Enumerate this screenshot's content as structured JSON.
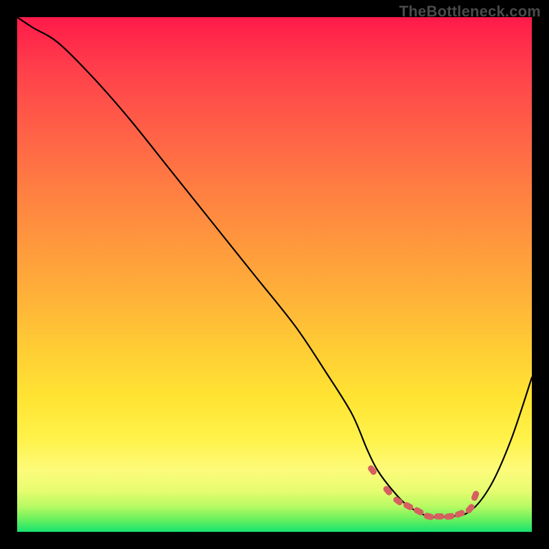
{
  "watermark": "TheBottleneck.com",
  "colors": {
    "background": "#000000",
    "line": "#000000",
    "markers": "#d66060",
    "gradient_top": "#ff1a4a",
    "gradient_bottom": "#17e36e"
  },
  "chart_data": {
    "type": "line",
    "title": "",
    "xlabel": "",
    "ylabel": "",
    "xlim": [
      0,
      100
    ],
    "ylim": [
      0,
      100
    ],
    "grid": false,
    "legend": false,
    "annotations": [
      "TheBottleneck.com"
    ],
    "series": [
      {
        "name": "curve",
        "x": [
          0,
          3,
          8,
          15,
          22,
          30,
          38,
          46,
          54,
          60,
          65,
          68,
          70,
          73,
          76,
          80,
          84,
          88,
          92,
          96,
          100
        ],
        "y": [
          100,
          98,
          95,
          88,
          80,
          70,
          60,
          50,
          40,
          31,
          23,
          16,
          12,
          8,
          5,
          3,
          3,
          4,
          9,
          18,
          30
        ]
      }
    ],
    "markers": {
      "name": "highlighted-points",
      "x": [
        69,
        72,
        74,
        76,
        78,
        80,
        82,
        84,
        86,
        88,
        89
      ],
      "y": [
        12,
        8,
        6,
        5,
        4,
        3,
        3,
        3,
        3.5,
        4.5,
        7
      ]
    }
  }
}
